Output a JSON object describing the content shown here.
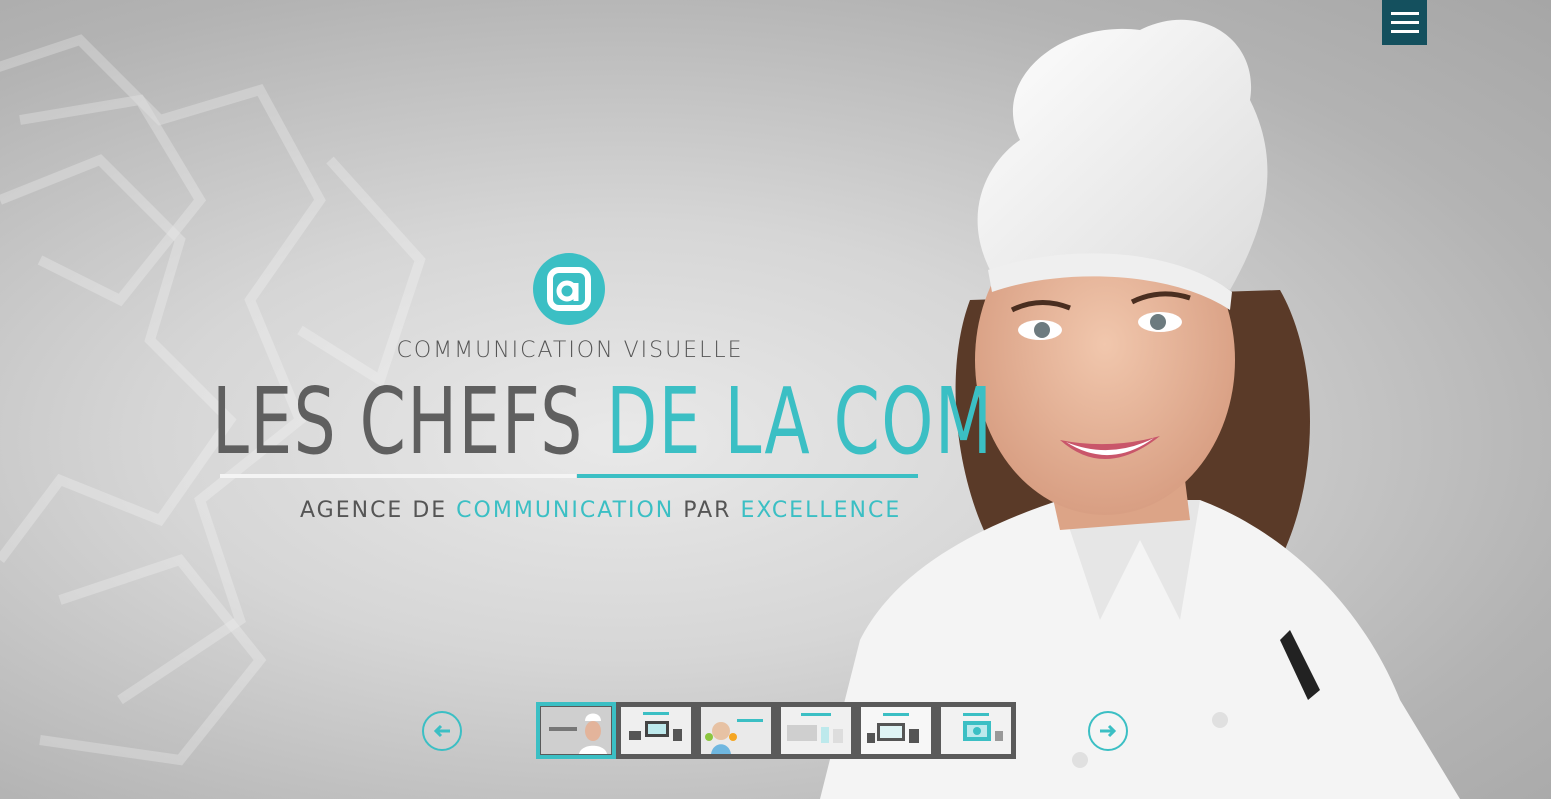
{
  "hero": {
    "kicker": "COMMUNICATION VISUELLE",
    "title_part1": "LES CHEFS ",
    "title_part2": "DE LA COM",
    "tagline_part1": "AGENCE DE ",
    "tagline_part2": "COMMUNICATION",
    "tagline_part3": " PAR ",
    "tagline_part4": "EXCELLENCE"
  },
  "colors": {
    "accent": "#3bbfc4",
    "menu_bg": "#14505e",
    "text": "#5f5f5f"
  },
  "icons": {
    "menu": "hamburger-icon",
    "logo": "brand-logo",
    "prev": "arrow-left-icon",
    "next": "arrow-right-icon"
  },
  "carousel": {
    "active_index": 0,
    "slides": [
      {
        "name": "slide-chef"
      },
      {
        "name": "slide-devices"
      },
      {
        "name": "slide-child"
      },
      {
        "name": "slide-office"
      },
      {
        "name": "slide-screens"
      },
      {
        "name": "slide-web"
      }
    ]
  }
}
